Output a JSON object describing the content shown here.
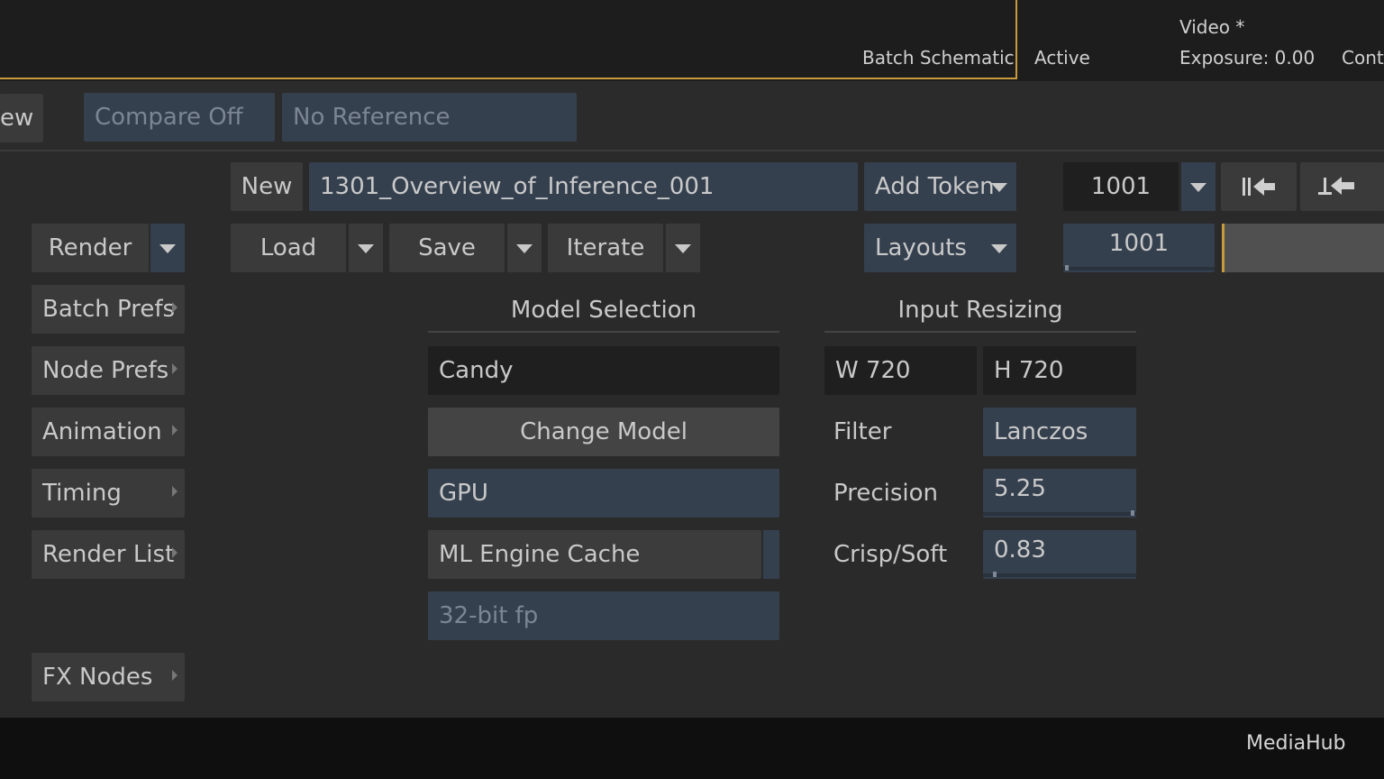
{
  "top": {
    "batch_schematic": "Batch Schematic",
    "active": "Active",
    "video": "Video *",
    "exposure": "Exposure: 0.00",
    "contrast_partial": "Contr"
  },
  "viewbar": {
    "view_partial": "ew",
    "compare": "Compare Off",
    "reference": "No Reference"
  },
  "setup": {
    "new_label": "New",
    "name_value": "1301_Overview_of_Inference_001",
    "add_token": "Add Token",
    "frame_value": "1001",
    "frame_slider_value": "1001",
    "layouts": "Layouts"
  },
  "actions": {
    "render": "Render",
    "load": "Load",
    "save": "Save",
    "iterate": "Iterate"
  },
  "sidebar": {
    "items": [
      {
        "label": "Batch Prefs"
      },
      {
        "label": "Node Prefs"
      },
      {
        "label": "Animation"
      },
      {
        "label": "Timing"
      },
      {
        "label": "Render List"
      },
      {
        "label": "FX Nodes"
      }
    ]
  },
  "model": {
    "header": "Model Selection",
    "name": "Candy",
    "change_button": "Change Model",
    "device": "GPU",
    "cache": "ML Engine Cache",
    "precision_mode": "32-bit fp"
  },
  "resize": {
    "header": "Input Resizing",
    "width": "W 720",
    "height": "H 720",
    "filter_label": "Filter",
    "filter_value": "Lanczos",
    "precision_label": "Precision",
    "precision_value": "5.25",
    "crisp_label": "Crisp/Soft",
    "crisp_value": "0.83"
  },
  "footer": {
    "mediahub": "MediaHub"
  },
  "colors": {
    "accent_gold": "#c79a3d",
    "button_blue": "#35404f",
    "button_grey": "#3a3a3a",
    "field_dark": "#1f1f1f"
  }
}
